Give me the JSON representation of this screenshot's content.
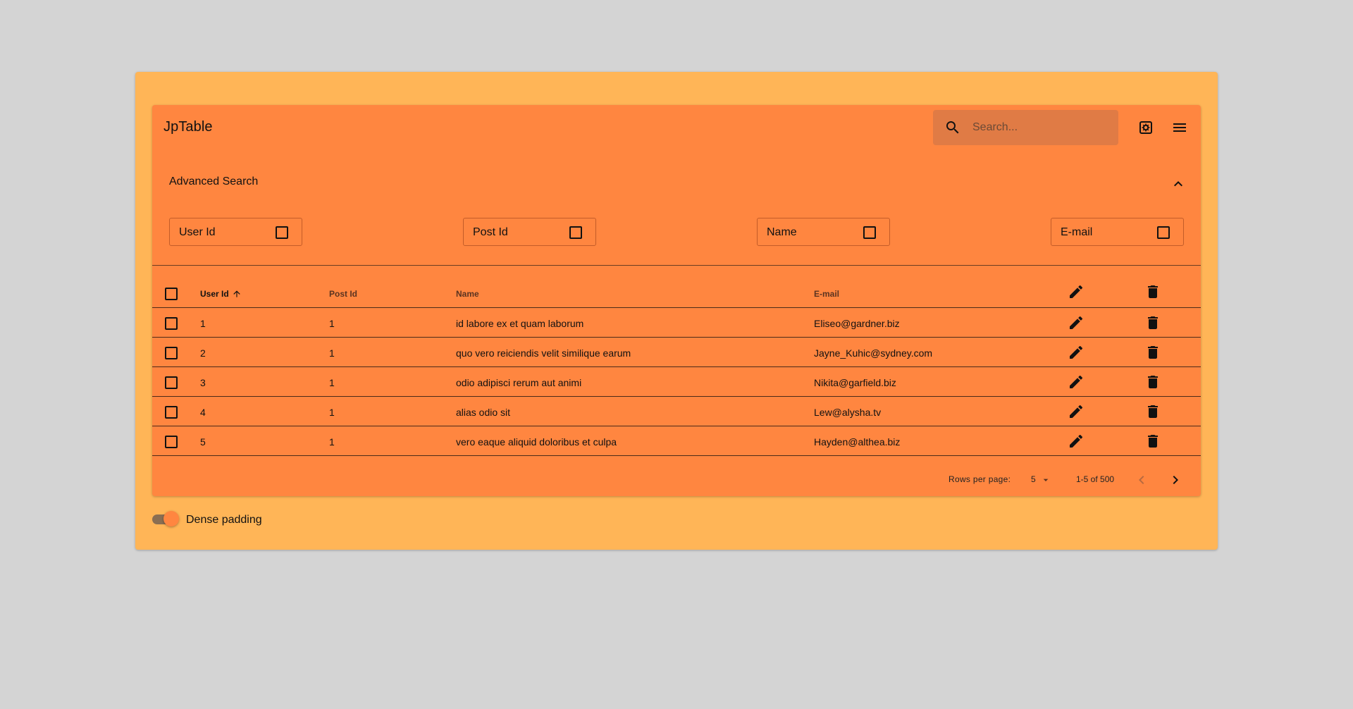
{
  "app": {
    "title": "JpTable"
  },
  "search": {
    "placeholder": "Search...",
    "icon": "search-icon"
  },
  "toolbar": {
    "icons": [
      "settings-icon",
      "menu-icon"
    ]
  },
  "advanced_search": {
    "title": "Advanced Search",
    "expanded": true,
    "fields": [
      {
        "label": "User Id",
        "checked": false
      },
      {
        "label": "Post Id",
        "checked": false
      },
      {
        "label": "Name",
        "checked": false
      },
      {
        "label": "E-mail",
        "checked": false
      }
    ]
  },
  "table": {
    "columns": [
      {
        "label": "User Id",
        "sorted": "asc"
      },
      {
        "label": "Post Id"
      },
      {
        "label": "Name"
      },
      {
        "label": "E-mail"
      }
    ],
    "rows": [
      {
        "user_id": "1",
        "post_id": "1",
        "name": "id labore ex et quam laborum",
        "email": "Eliseo@gardner.biz"
      },
      {
        "user_id": "2",
        "post_id": "1",
        "name": "quo vero reiciendis velit similique earum",
        "email": "Jayne_Kuhic@sydney.com"
      },
      {
        "user_id": "3",
        "post_id": "1",
        "name": "odio adipisci rerum aut animi",
        "email": "Nikita@garfield.biz"
      },
      {
        "user_id": "4",
        "post_id": "1",
        "name": "alias odio sit",
        "email": "Lew@alysha.tv"
      },
      {
        "user_id": "5",
        "post_id": "1",
        "name": "vero eaque aliquid doloribus et culpa",
        "email": "Hayden@althea.biz"
      }
    ]
  },
  "pagination": {
    "rows_per_page_label": "Rows per page:",
    "rows_per_page": "5",
    "range": "1-5 of 500"
  },
  "dense": {
    "label": "Dense padding",
    "on": true
  },
  "colors": {
    "page_bg": "#d4d4d4",
    "outer_bg": "#ffb557",
    "paper_bg": "#ff8640",
    "search_bg": "#e07b45"
  }
}
